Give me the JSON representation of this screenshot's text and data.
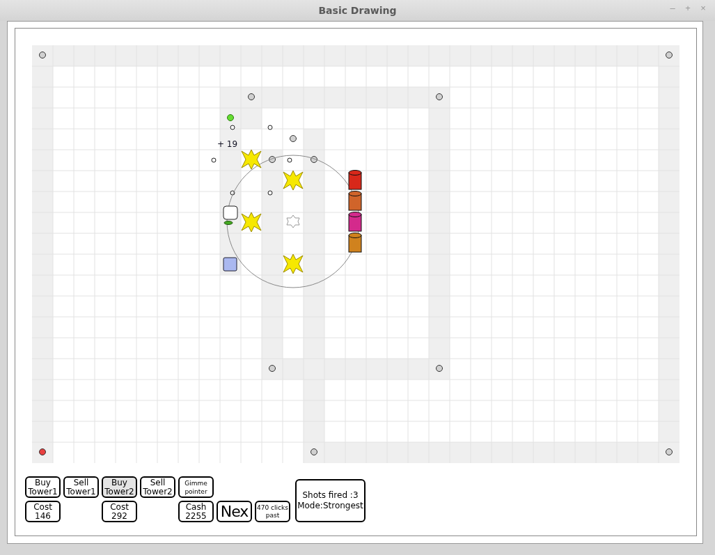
{
  "window": {
    "title": "Basic Drawing",
    "controls": [
      "–",
      "+",
      "×"
    ]
  },
  "board": {
    "reward_text": "+ 19",
    "enemies": [
      {
        "color": "#d8281a"
      },
      {
        "color": "#d0642a"
      },
      {
        "color": "#d42a8c"
      },
      {
        "color": "#d0821e"
      }
    ]
  },
  "shop_columns": [
    {
      "button": {
        "label": "Buy\nTower1",
        "selected": false
      },
      "info": "Cost\n146"
    },
    {
      "button": {
        "label": "Sell\nTower1",
        "selected": false
      }
    },
    {
      "button": {
        "label": "Buy\nTower2",
        "selected": true
      },
      "info": "Cost\n292"
    },
    {
      "button": {
        "label": "Sell\nTower2",
        "selected": false
      }
    },
    {
      "button": {
        "label": "Gimme\npointer",
        "selected": false,
        "small": true
      },
      "info": "Cash\n2255"
    },
    {
      "next": "Nex"
    },
    {
      "clicks": "470 clicks\npast"
    }
  ],
  "status": "Shots fired :3\nMode:Strongest"
}
